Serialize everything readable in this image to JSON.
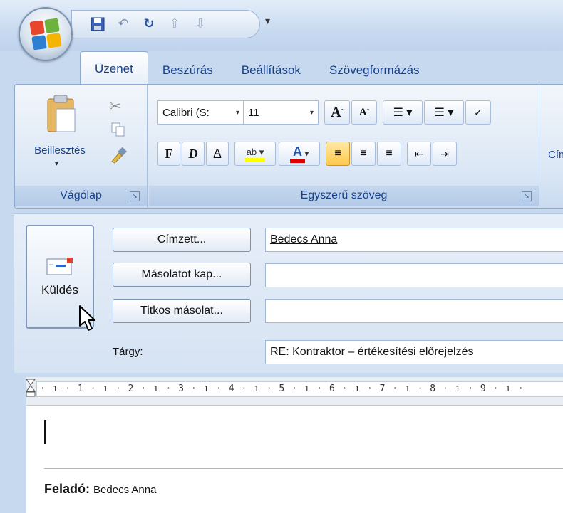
{
  "ribbon": {
    "tabs": [
      {
        "label": "Üzenet",
        "active": true
      },
      {
        "label": "Beszúrás",
        "active": false
      },
      {
        "label": "Beállítások",
        "active": false
      },
      {
        "label": "Szövegformázás",
        "active": false
      }
    ],
    "clipboard": {
      "paste_label": "Beillesztés",
      "group_label": "Vágólap"
    },
    "basic_text": {
      "font_name": "Calibri (S:",
      "font_size": "11",
      "bold": "F",
      "italic": "D",
      "underline": "A",
      "group_label": "Egyszerű szöveg"
    },
    "next_group_partial": "Cím"
  },
  "form": {
    "send_label": "Küldés",
    "to_button": "Címzett...",
    "cc_button": "Másolatot kap...",
    "bcc_button": "Titkos másolat...",
    "subject_label": "Tárgy:",
    "to_value": "Bedecs Anna",
    "cc_value": "",
    "bcc_value": "",
    "subject_value": "RE:  Kontraktor – értékesítési előrejelzés"
  },
  "ruler": {
    "text": "· ı · 1 · ı · 2 · ı · 3 · ı · 4 · ı · 5 · ı · 6 · ı · 7 · ı · 8 · ı · 9 · ı ·"
  },
  "body": {
    "from_label": "Feladó:",
    "from_value": "Bedecs Anna"
  },
  "colors": {
    "accent": "#15428b",
    "ribbon_bg": "#dbe7f5",
    "highlight_yellow": "#ffff00",
    "font_color_red": "#e00000",
    "align_active": "#ffd55a"
  },
  "icons": {
    "office_button": "office-logo-icon",
    "save": "save-icon",
    "undo": "undo-icon",
    "redo": "redo-icon",
    "up": "up-arrow-icon",
    "down": "down-arrow-icon",
    "paste": "clipboard-icon",
    "cut": "scissors-icon",
    "copy": "copy-icon",
    "format_painter": "format-painter-icon",
    "send": "envelope-icon"
  }
}
